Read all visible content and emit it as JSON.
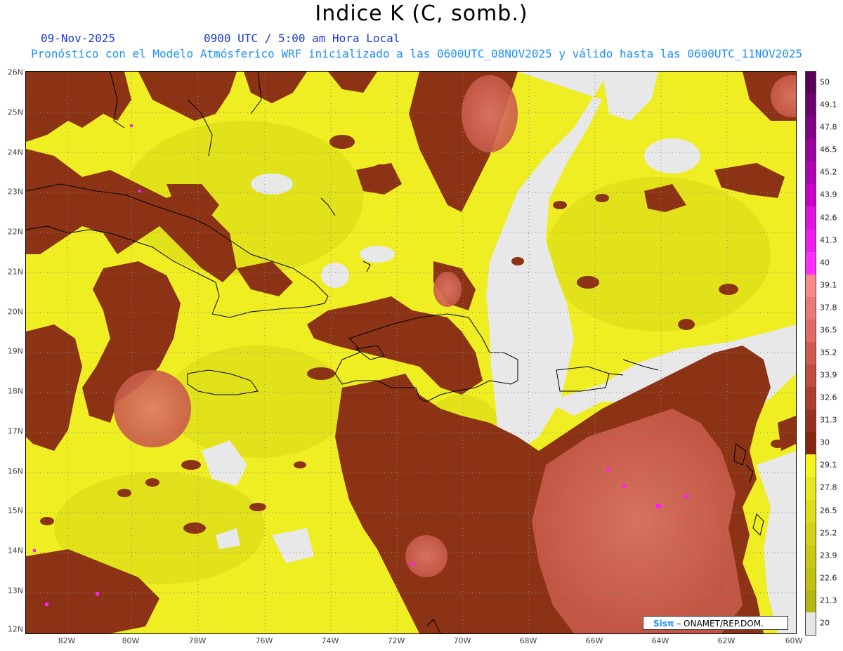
{
  "title": "Indice K (C, somb.)",
  "subtitle": {
    "date": "09-Nov-2025",
    "time": "0900 UTC / 5:00 am Hora Local",
    "model": "Pronóstico con el Modelo Atmósferico WRF inicializado a las 0600UTC_08NOV2025 y válido hasta las  0600UTC_11NOV2025"
  },
  "map": {
    "lat_labels": [
      "26N",
      "25N",
      "24N",
      "23N",
      "22N",
      "21N",
      "20N",
      "19N",
      "18N",
      "17N",
      "16N",
      "15N",
      "14N",
      "13N",
      "12N"
    ],
    "lon_labels": [
      "82W",
      "80W",
      "78W",
      "76W",
      "74W",
      "72W",
      "70W",
      "68W",
      "66W",
      "64W",
      "62W",
      "60W"
    ],
    "colors": {
      "no_data": "#e8e8e8",
      "yellow": "#f2f227",
      "yellow_dark": "#d6d615",
      "brown": "#8b3314",
      "salmon": "#d66a5a",
      "magenta": "#ff1cff"
    }
  },
  "colorbar": {
    "labels": [
      "50",
      "49.1",
      "47.8",
      "46.5",
      "45.2",
      "43.9",
      "42.6",
      "41.3",
      "40",
      "39.1",
      "37.8",
      "36.5",
      "35.2",
      "33.9",
      "32.6",
      "31.3",
      "30",
      "29.1",
      "27.8",
      "26.5",
      "25.2",
      "23.9",
      "22.6",
      "21.3",
      "20"
    ],
    "colors": [
      "#5a005a",
      "#6e0070",
      "#820085",
      "#99009c",
      "#b000b2",
      "#c800c8",
      "#dc14dc",
      "#ee1cee",
      "#ff2cff",
      "#fa8a8a",
      "#eb7878",
      "#e06a66",
      "#d05c50",
      "#c04c3e",
      "#ad3d2c",
      "#993020",
      "#85260f",
      "#f5f51c",
      "#e8e81a",
      "#dede18",
      "#d4d416",
      "#caca14",
      "#c0c012",
      "#b6b610",
      "#e6e6e6"
    ]
  },
  "credit": {
    "logo": "Sisπ",
    "text": " – ONAMET/REP.DOM."
  }
}
